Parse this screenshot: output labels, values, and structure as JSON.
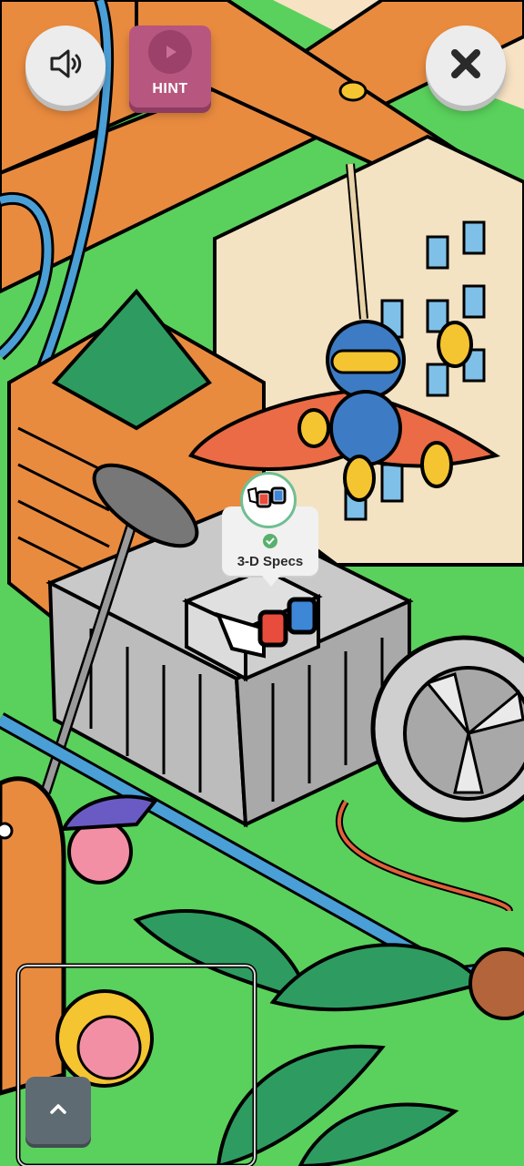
{
  "hud": {
    "sound_icon": "speaker-icon",
    "hint_label": "HINT",
    "hint_icon": "play-icon",
    "close_icon": "close-x-icon",
    "collapse_icon": "chevron-up-icon"
  },
  "found_item": {
    "name": "3-D Specs",
    "status_icon": "checkmark-icon",
    "thumbnail_icon": "3d-glasses-icon"
  },
  "colors": {
    "grass": "#5ad15c",
    "hint_button": "#b7567f",
    "collapse_button": "#5f6b73",
    "check_green": "#59b06d"
  }
}
